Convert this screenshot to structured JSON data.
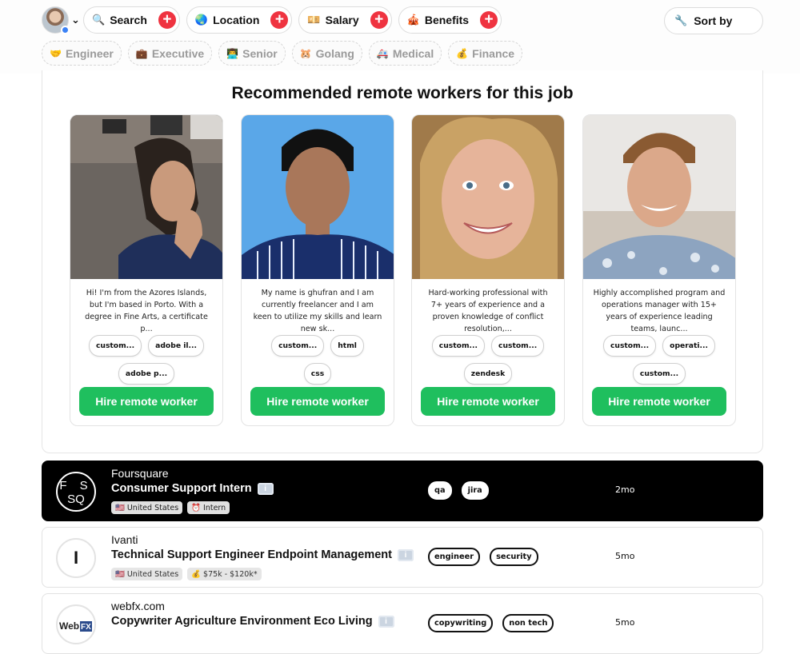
{
  "filters": {
    "search": {
      "icon": "🔍",
      "label": "Search"
    },
    "location": {
      "icon": "🌏",
      "label": "Location"
    },
    "salary": {
      "icon": "💴",
      "label": "Salary"
    },
    "benefits": {
      "icon": "🎪",
      "label": "Benefits"
    },
    "sort": {
      "icon": "🔧",
      "label": "Sort by"
    },
    "plus": "+",
    "chevron": "⌄"
  },
  "tags": [
    {
      "icon": "🤝",
      "label": "Engineer"
    },
    {
      "icon": "💼",
      "label": "Executive"
    },
    {
      "icon": "👨‍💻",
      "label": "Senior"
    },
    {
      "icon": "🐹",
      "label": "Golang"
    },
    {
      "icon": "🚑",
      "label": "Medical"
    },
    {
      "icon": "💰",
      "label": "Finance"
    }
  ],
  "recommended": {
    "title": "Recommended remote workers for this job",
    "hire_label": "Hire remote worker",
    "workers": [
      {
        "bio": "Hi! I'm from the Azores Islands, but I'm based in Porto. With a degree in Fine Arts, a certificate p...",
        "skills": [
          "custom...",
          "adobe il...",
          "adobe p..."
        ]
      },
      {
        "bio": "My name is ghufran and I am currently freelancer and I am keen to utilize my skills and learn new sk...",
        "skills": [
          "custom...",
          "html",
          "css"
        ]
      },
      {
        "bio": "Hard-working professional with 7+ years of experience and a proven knowledge of conflict resolution,...",
        "skills": [
          "custom...",
          "custom...",
          "zendesk"
        ]
      },
      {
        "bio": "Highly accomplished program and operations manager with 15+ years of experience leading teams, launc...",
        "skills": [
          "custom...",
          "operati...",
          "custom..."
        ]
      }
    ]
  },
  "jobs": [
    {
      "company": "Foursquare",
      "logo_text": "F S\nSQ",
      "title": "Consumer Support Intern",
      "info": "i",
      "tags": [
        "🇺🇸 United States",
        "⏰ Intern"
      ],
      "skills": [
        "qa",
        "jira"
      ],
      "age": "2mo"
    },
    {
      "company": "Ivanti",
      "logo_text": "I",
      "title": "Technical Support Engineer Endpoint Management",
      "info": "i",
      "tags": [
        "🇺🇸 United States",
        "💰 $75k - $120k*"
      ],
      "skills": [
        "engineer",
        "security"
      ],
      "age": "5mo"
    },
    {
      "company": "webfx.com",
      "logo_text": "WebFX",
      "title": "Copywriter Agriculture Environment Eco Living",
      "info": "i",
      "tags": [],
      "skills": [
        "copywriting",
        "non tech"
      ],
      "age": "5mo"
    }
  ]
}
